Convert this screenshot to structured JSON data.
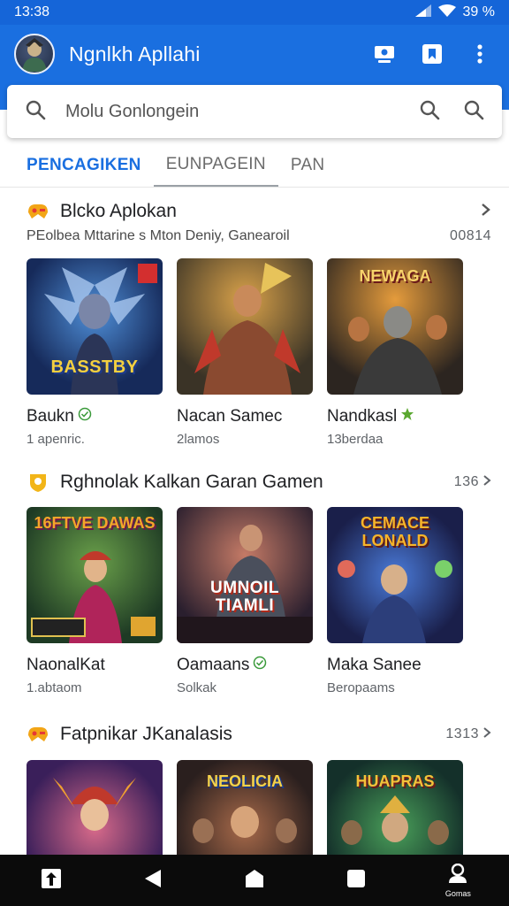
{
  "status": {
    "time": "13:38",
    "battery": "39 %"
  },
  "header": {
    "title": "Ngnlkh Apllahi"
  },
  "search": {
    "placeholder": "Molu Gonlongein"
  },
  "tabs": [
    {
      "label": "PENCAGIKEN"
    },
    {
      "label": "EUNPAGEIN"
    },
    {
      "label": "PAN"
    }
  ],
  "sections": [
    {
      "title": "Blcko Aplokan",
      "subtitle": "PEolbea Mttarine s Mton Deniy, Ganearoil",
      "count": "00814",
      "games": [
        {
          "name": "Baukn",
          "meta": "1 apenric.",
          "banner": "BASSTBY"
        },
        {
          "name": "Nacan Samec",
          "meta": "2lamos",
          "banner": ""
        },
        {
          "name": "Nandkasl",
          "meta": "13berdaa",
          "banner": "NEWAGA"
        }
      ]
    },
    {
      "title": "Rghnolak Kalkan Garan Gamen",
      "count": "136",
      "games": [
        {
          "name": "NaonalKat",
          "meta": "1.abtaom",
          "banner": "16FTVE DAWAS"
        },
        {
          "name": "Oamaans",
          "meta": "Solkak",
          "banner": "UMNOIL TIAMLI"
        },
        {
          "name": "Maka Sanee",
          "meta": "Beropaams",
          "banner": "CEMACE LONALD"
        }
      ]
    },
    {
      "title": "Fatpnikar JKanalasis",
      "count": "1313",
      "games": [
        {
          "name": "",
          "meta": "",
          "banner": ""
        },
        {
          "name": "",
          "meta": "",
          "banner": "NEOLICIA"
        },
        {
          "name": "",
          "meta": "",
          "banner": "HUAPRAS"
        }
      ]
    }
  ],
  "navbar": {
    "profile_label": "Gomas"
  },
  "colors": {
    "primary": "#1a6fe0",
    "status": "#1565d8",
    "navbar": "#0b0b0b"
  }
}
